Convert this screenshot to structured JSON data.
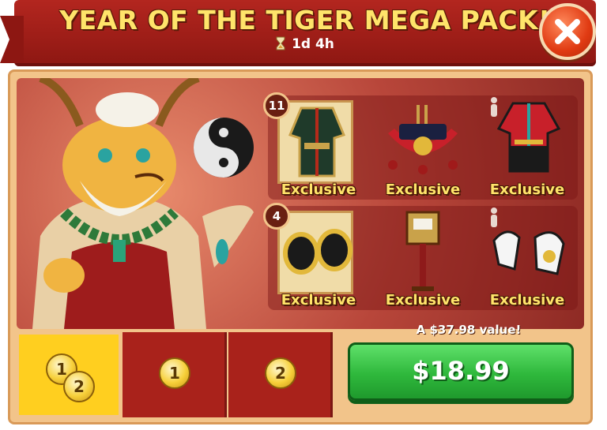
{
  "header": {
    "title": "YEAR OF THE TIGER MEGA PACK!",
    "timer": "1d 4h"
  },
  "items": {
    "row1": [
      {
        "count": "11",
        "label": "Exclusive",
        "icon": "robe-armor-icon"
      },
      {
        "label": "Exclusive",
        "icon": "shrine-cart-icon"
      },
      {
        "label": "Exclusive",
        "icon": "red-tunic-icon"
      }
    ],
    "row2": [
      {
        "count": "4",
        "label": "Exclusive",
        "icon": "gold-shoes-icon"
      },
      {
        "label": "Exclusive",
        "icon": "lantern-staff-icon"
      },
      {
        "label": "Exclusive",
        "icon": "claw-gloves-icon"
      }
    ]
  },
  "tabs": [
    {
      "coins": [
        "1",
        "2"
      ],
      "selected": true
    },
    {
      "coins": [
        "1"
      ],
      "selected": false
    },
    {
      "coins": [
        "2"
      ],
      "selected": false
    }
  ],
  "purchase": {
    "value_text": "A $37.98 value!",
    "price": "$18.99"
  },
  "colors": {
    "title": "#ffe46a",
    "buy_button": "#2fb83c",
    "banner": "#b3261f",
    "selected_tab": "#ffcf1f"
  }
}
